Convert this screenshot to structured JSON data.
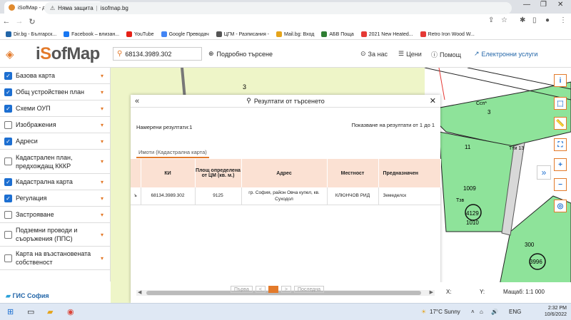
{
  "browser": {
    "tab_title": "iSofMap - достъп до цифрови д",
    "tab_close": "×",
    "new_tab": "+",
    "address_warning": "Няма защита",
    "address_url": "isofmap.bg",
    "bookmarks": [
      {
        "label": "Dir.bg - Българск...",
        "color": "#2366a8"
      },
      {
        "label": "Facebook – влизан...",
        "color": "#1877f2"
      },
      {
        "label": "YouTube",
        "color": "#e62117"
      },
      {
        "label": "Google Преводач",
        "color": "#4285f4"
      },
      {
        "label": "ЦГМ - Разписания -",
        "color": "#555555"
      },
      {
        "label": "Mail.bg: Вход",
        "color": "#e5a41b"
      },
      {
        "label": "АБВ Поща",
        "color": "#2e7d32"
      },
      {
        "label": "2021 New Heated...",
        "color": "#e53935"
      },
      {
        "label": "Retro Iron Wood W...",
        "color": "#e53935"
      }
    ]
  },
  "app": {
    "logo_prefix": "i",
    "logo_o": "S",
    "logo_rest": "ofMap",
    "search_value": "68134.3989.302",
    "advanced_search": "Подробно търсене",
    "about": "За нас",
    "prices": "Цени",
    "help": "Помощ",
    "eservices": "Електронни услуги",
    "gis_logo": "ГИС София"
  },
  "sidebar": {
    "layers": [
      {
        "label": "Базова карта",
        "checked": true
      },
      {
        "label": "Общ устройствен план",
        "checked": true
      },
      {
        "label": "Схеми ОУП",
        "checked": true
      },
      {
        "label": "Изображения",
        "checked": false
      },
      {
        "label": "Адреси",
        "checked": true
      },
      {
        "label": "Кадастрален план, предхождащ КККР",
        "checked": false
      },
      {
        "label": "Кадастрална карта",
        "checked": true
      },
      {
        "label": "Регулация",
        "checked": true
      },
      {
        "label": "Застрояване",
        "checked": false
      },
      {
        "label": "Подземни проводи и съоръжения (ППС)",
        "checked": false
      },
      {
        "label": "Карта на възстановената собственост",
        "checked": false
      }
    ]
  },
  "results": {
    "title": "Резултати от търсенето",
    "found": "Намерени резултати:1",
    "shown": "Показване на резултати от 1 до 1",
    "tab": "Имоти (Кадастрална карта)",
    "columns": [
      "КИ",
      "Площ определена от ЦМ (кв. м.)",
      "Адрес",
      "Местност",
      "Предназначен"
    ],
    "rows": [
      {
        "marker": "ъ",
        "ki": "68134.3989.302",
        "area": "9125",
        "address": "гр. София, район Овча купел, кв. Суходол",
        "locality": "КЛЮНЧОВ РИД",
        "purpose": "Земеделск"
      }
    ],
    "pager": [
      "Първа",
      "<",
      "1",
      ">",
      "Последна"
    ]
  },
  "map": {
    "labels": [
      "3",
      "3",
      "Ссп*",
      "11",
      "Тти 13",
      "1009",
      "Тзв",
      "4129",
      "1010",
      "300",
      "3996"
    ],
    "x_label": "X:",
    "y_label": "Y:",
    "scale": "Мащаб: 1:1 000"
  },
  "taskbar": {
    "weather": "17°C  Sunny",
    "lang": "ENG",
    "time": "2:32 PM",
    "date": "10/6/2022"
  }
}
